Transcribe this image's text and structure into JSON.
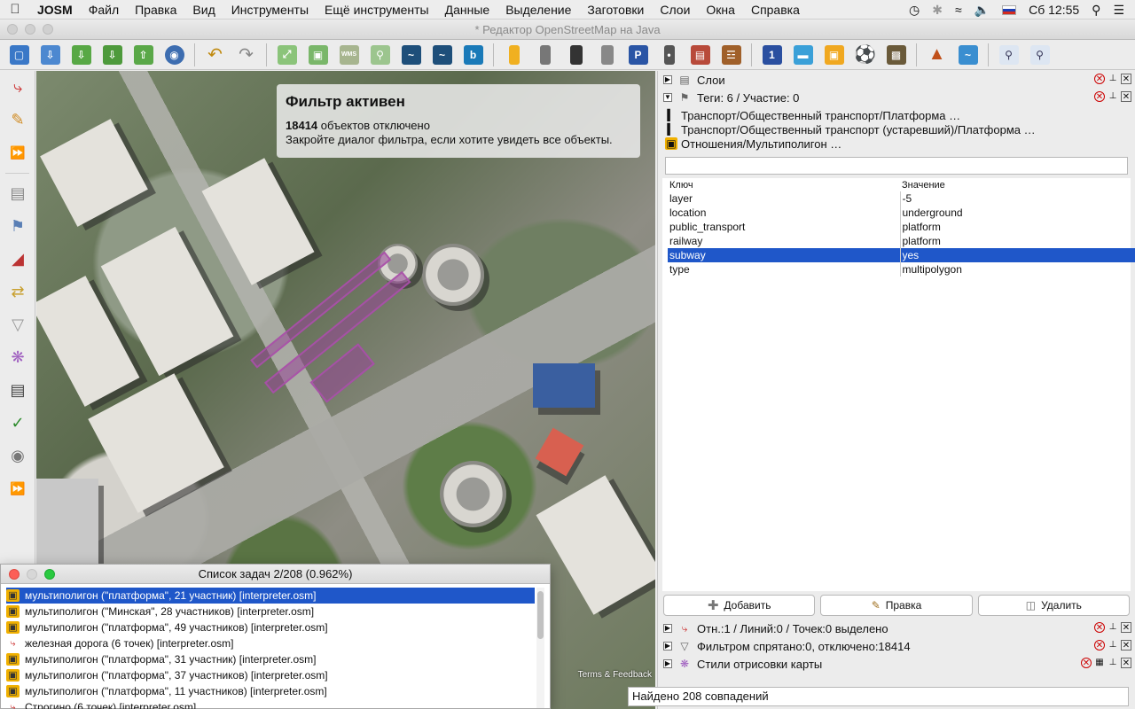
{
  "menubar": {
    "app": "JOSM",
    "items": [
      "Файл",
      "Правка",
      "Вид",
      "Инструменты",
      "Ещё инструменты",
      "Данные",
      "Выделение",
      "Заготовки",
      "Слои",
      "Окна",
      "Справка"
    ],
    "clock": "Сб 12:55"
  },
  "window": {
    "title": "* Редактор OpenStreetMap на Java"
  },
  "map": {
    "filter_title": "Фильтр активен",
    "filter_count": "18414",
    "filter_line1_suffix": " объектов отключено",
    "filter_line2": "Закройте диалог фильтра, если хотите увидеть все объекты.",
    "terms": "Terms & Feedback"
  },
  "panels": {
    "layers": "Слои",
    "tags": "Теги: 6 / Участие: 0",
    "selection": "Отн.:1 / Линий:0 / Точек:0 выделено",
    "filter": "Фильтром спрятано:0, отключено:18414",
    "styles": "Стили отрисовки карты"
  },
  "presets": [
    "Транспорт/Общественный транспорт/Платформа …",
    "Транспорт/Общественный транспорт (устаревший)/Платформа …",
    "Отношения/Мультиполигон …"
  ],
  "tag_table": {
    "key_header": "Ключ",
    "value_header": "Значение",
    "rows": [
      {
        "key": "layer",
        "value": "-5"
      },
      {
        "key": "location",
        "value": "underground"
      },
      {
        "key": "public_transport",
        "value": "platform"
      },
      {
        "key": "railway",
        "value": "platform"
      },
      {
        "key": "subway",
        "value": "yes"
      },
      {
        "key": "type",
        "value": "multipolygon"
      }
    ]
  },
  "buttons": {
    "add": "Добавить",
    "edit": "Правка",
    "delete": "Удалить"
  },
  "status": "Найдено 208 совпадений",
  "tasklist": {
    "title": "Список задач 2/208 (0.962%)",
    "items": [
      "мультиполигон (\"платформа\", 21 участник) [interpreter.osm]",
      "мультиполигон (\"Минская\", 28 участников) [interpreter.osm]",
      "мультиполигон (\"платформа\", 49 участников) [interpreter.osm]",
      "железная дорога (6 точек) [interpreter.osm]",
      "мультиполигон (\"платформа\", 31 участник) [interpreter.osm]",
      "мультиполигон (\"платформа\", 37 участников) [interpreter.osm]",
      "мультиполигон (\"платформа\", 11 участников) [interpreter.osm]",
      "Строгино (6 точек) [interpreter.osm]"
    ]
  }
}
